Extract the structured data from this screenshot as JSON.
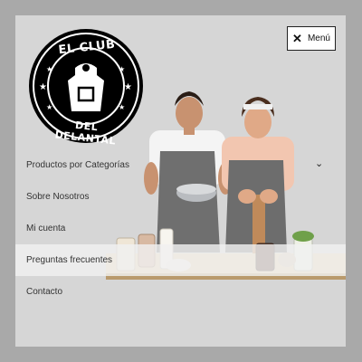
{
  "logo": {
    "line1": "EL CLUB",
    "line2": "DEL DELANTAL",
    "icon": "apron-icon"
  },
  "menu_button": {
    "label": "Menú",
    "icon": "close-icon"
  },
  "nav": {
    "items": [
      {
        "label": "Productos por Categorías",
        "has_submenu": true
      },
      {
        "label": "Sobre Nosotros"
      },
      {
        "label": "Mi cuenta"
      },
      {
        "label": "Preguntas frecuentes",
        "highlighted": true
      },
      {
        "label": "Contacto"
      }
    ]
  },
  "hero": {
    "image": "two-chefs-in-aprons-kitchen-photo"
  },
  "colors": {
    "page_bg": "#a9a9a9",
    "panel_bg": "#d6d6d6",
    "logo_bg": "#000000"
  }
}
